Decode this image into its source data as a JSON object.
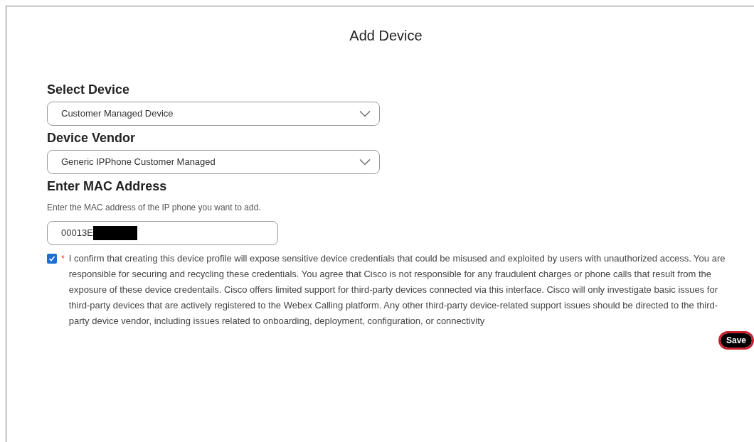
{
  "title": "Add Device",
  "fields": [
    {
      "kind": "select",
      "label": "Select Device",
      "value": "Customer Managed Device"
    },
    {
      "kind": "select",
      "label": "Device Vendor",
      "value": "Generic IPPhone Customer Managed"
    },
    {
      "kind": "text",
      "label": "Enter MAC Address",
      "hint": "Enter the MAC address of the IP phone you want to add.",
      "value": "00013E",
      "redacted": true
    }
  ],
  "consent": {
    "checked": true,
    "required_mark": "*",
    "text": "I confirm that creating this device profile will expose sensitive device credentials that could be misused and exploited by users with unauthorized access. You are responsible for securing and recycling these credentials. You agree that Cisco is not responsible for any fraudulent charges or phone calls that result from the exposure of these device credentails. Cisco offers limited support for third-party devices connected via this interface. Cisco will only investigate basic issues for third-party devices that are actively registered to the Webex Calling platform. Any other third-party device-related support issues should be directed to the third-party device vendor, including issues related to onboarding, deployment, configuration, or connectivity"
  },
  "save_button": {
    "label": "Save",
    "highlighted": true
  }
}
